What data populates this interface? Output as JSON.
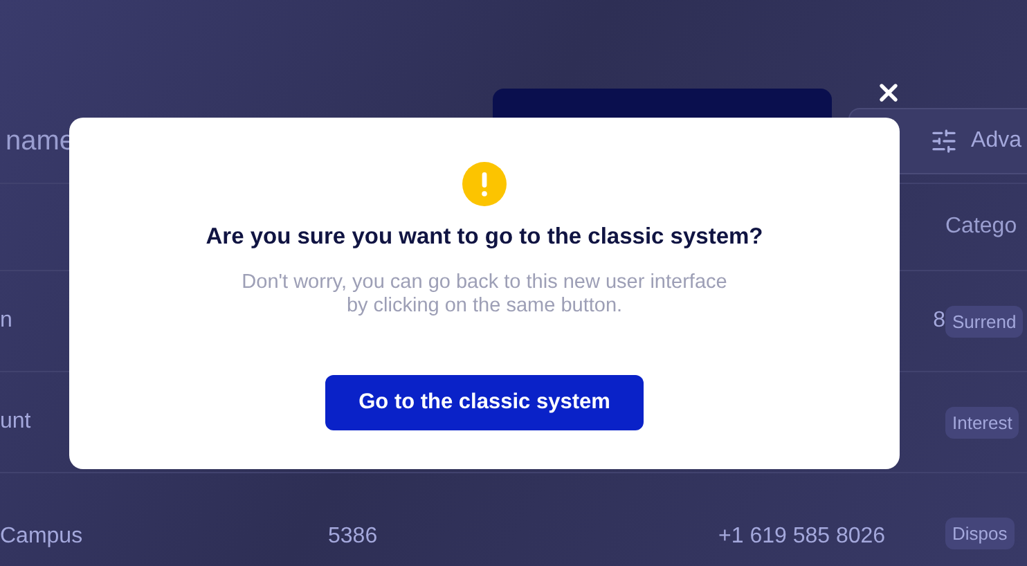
{
  "toolbar": {
    "search": {
      "placeholder": "name"
    },
    "advanced_button": "Adva"
  },
  "table": {
    "columns": [
      "",
      "",
      "",
      "Catego"
    ],
    "rows": [
      {
        "cells": [
          "n",
          "",
          "8"
        ],
        "category": "Surrend"
      },
      {
        "cells": [
          "unt",
          "",
          ""
        ],
        "category": "Interest"
      },
      {
        "cells": [
          "Campus",
          "5386",
          "+1 619 585 8026"
        ],
        "category": "Dispos"
      }
    ]
  },
  "dialog": {
    "title": "Are you sure you want to go to the classic system?",
    "message": "Don't worry, you can go back to this new user interface by clicking on the same button.",
    "confirm_button": "Go to the classic system"
  }
}
